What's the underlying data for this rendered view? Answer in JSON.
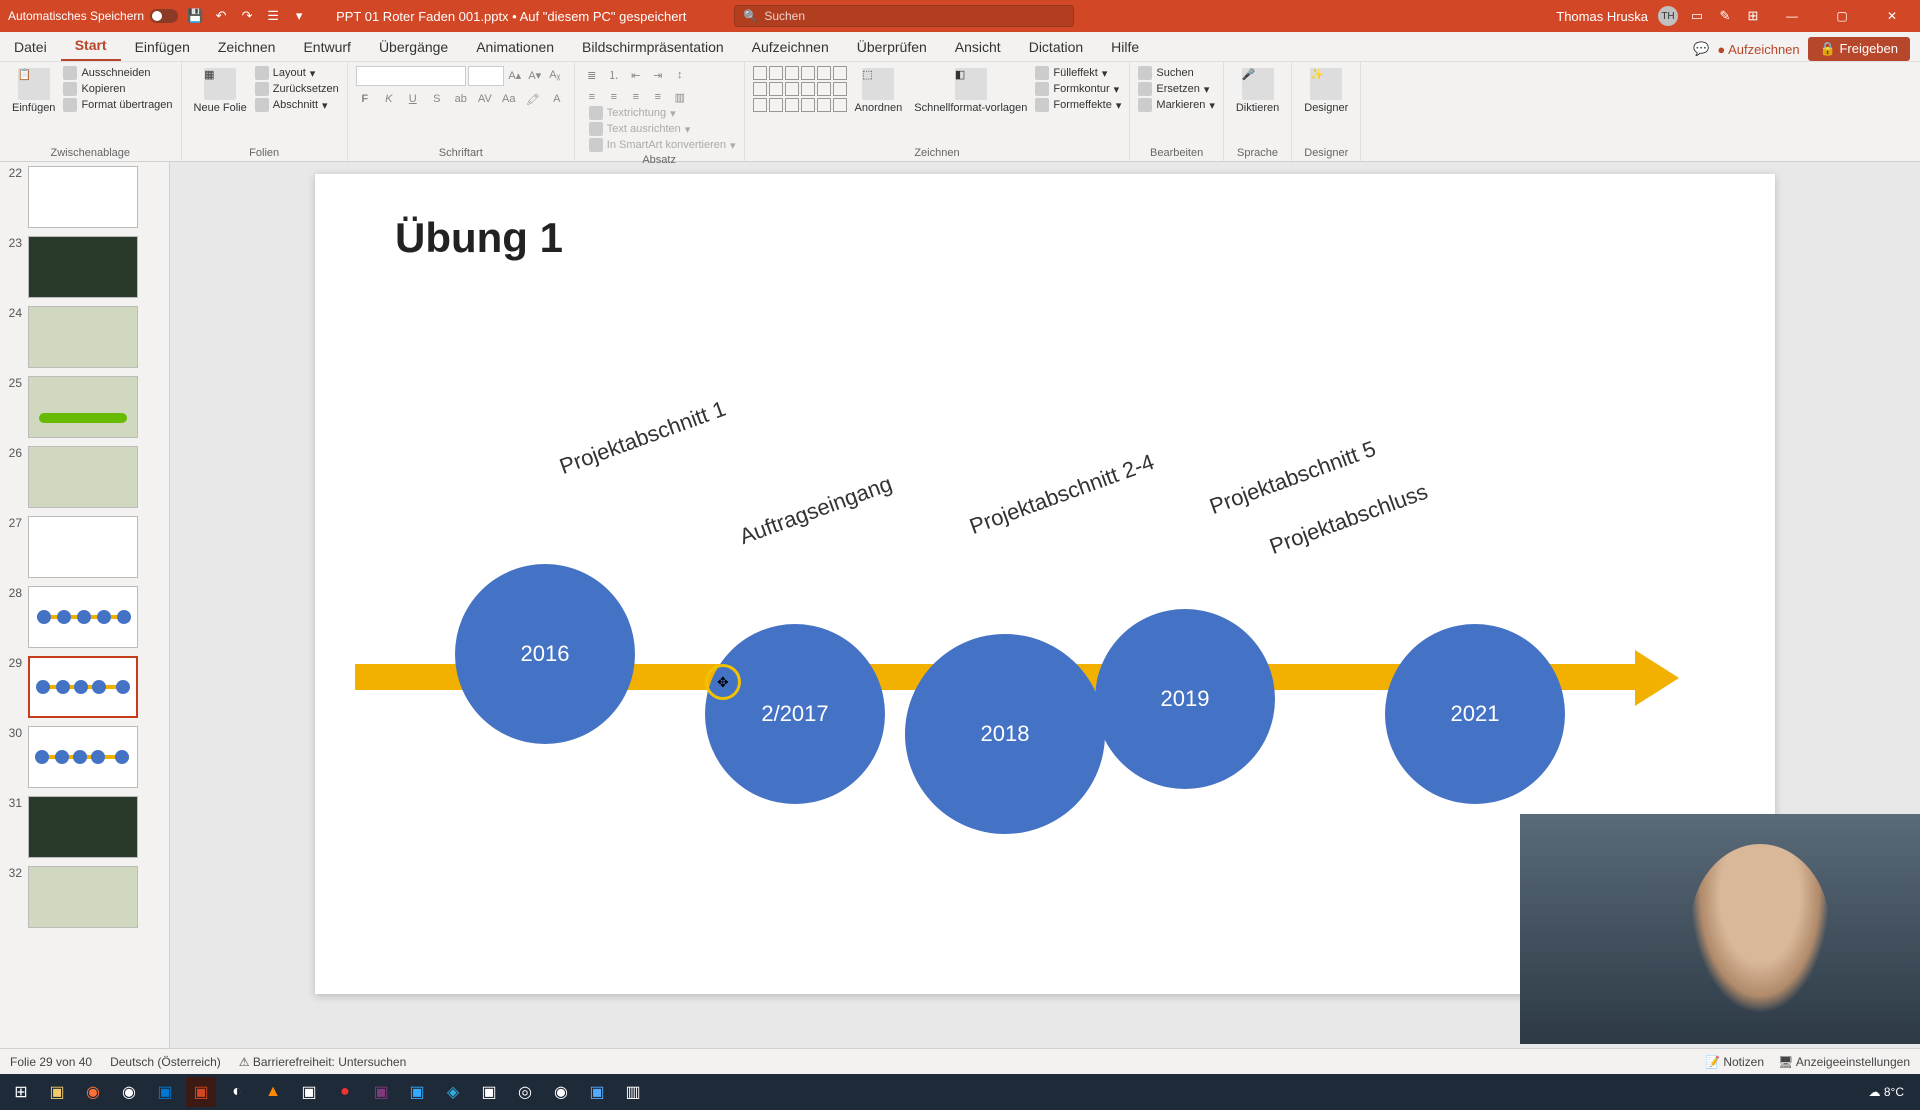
{
  "titlebar": {
    "autosave": "Automatisches Speichern",
    "filename": "PPT 01 Roter Faden 001.pptx • Auf \"diesem PC\" gespeichert",
    "search_placeholder": "Suchen",
    "user": "Thomas Hruska",
    "user_initials": "TH"
  },
  "menu": {
    "tabs": [
      "Datei",
      "Start",
      "Einfügen",
      "Zeichnen",
      "Entwurf",
      "Übergänge",
      "Animationen",
      "Bildschirmpräsentation",
      "Aufzeichnen",
      "Überprüfen",
      "Ansicht",
      "Dictation",
      "Hilfe"
    ],
    "active": "Start",
    "record": "Aufzeichnen",
    "share": "Freigeben"
  },
  "ribbon": {
    "paste": "Einfügen",
    "cut": "Ausschneiden",
    "copy": "Kopieren",
    "format_painter": "Format übertragen",
    "clipboard": "Zwischenablage",
    "new_slide": "Neue Folie",
    "layout": "Layout",
    "reset": "Zurücksetzen",
    "section": "Abschnitt",
    "slides": "Folien",
    "font": "Schriftart",
    "paragraph": "Absatz",
    "text_direction": "Textrichtung",
    "align_text": "Text ausrichten",
    "smartart": "In SmartArt konvertieren",
    "arrange": "Anordnen",
    "quick_styles": "Schnellformat-vorlagen",
    "fill": "Fülleffekt",
    "outline": "Formkontur",
    "effects": "Formeffekte",
    "drawing": "Zeichnen",
    "find": "Suchen",
    "replace": "Ersetzen",
    "select": "Markieren",
    "editing": "Bearbeiten",
    "dictate": "Diktieren",
    "speech": "Sprache",
    "designer": "Designer",
    "designer_grp": "Designer"
  },
  "thumbs": {
    "numbers": [
      "22",
      "23",
      "24",
      "25",
      "26",
      "27",
      "28",
      "29",
      "30",
      "31",
      "32"
    ],
    "selected": "29"
  },
  "slide": {
    "title": "Übung 1",
    "labels": [
      "Projektabschnitt 1",
      "Auftragseingang",
      "Projektabschnitt 2-4",
      "Projektabschnitt 5",
      "Projektabschluss"
    ],
    "bubbles": [
      "2016",
      "2/2017",
      "2018",
      "2019",
      "2021"
    ]
  },
  "status": {
    "slide_count": "Folie 29 von 40",
    "language": "Deutsch (Österreich)",
    "accessibility": "Barrierefreiheit: Untersuchen",
    "notes": "Notizen",
    "display": "Anzeigeeinstellungen"
  },
  "taskbar": {
    "weather": "8°C"
  }
}
